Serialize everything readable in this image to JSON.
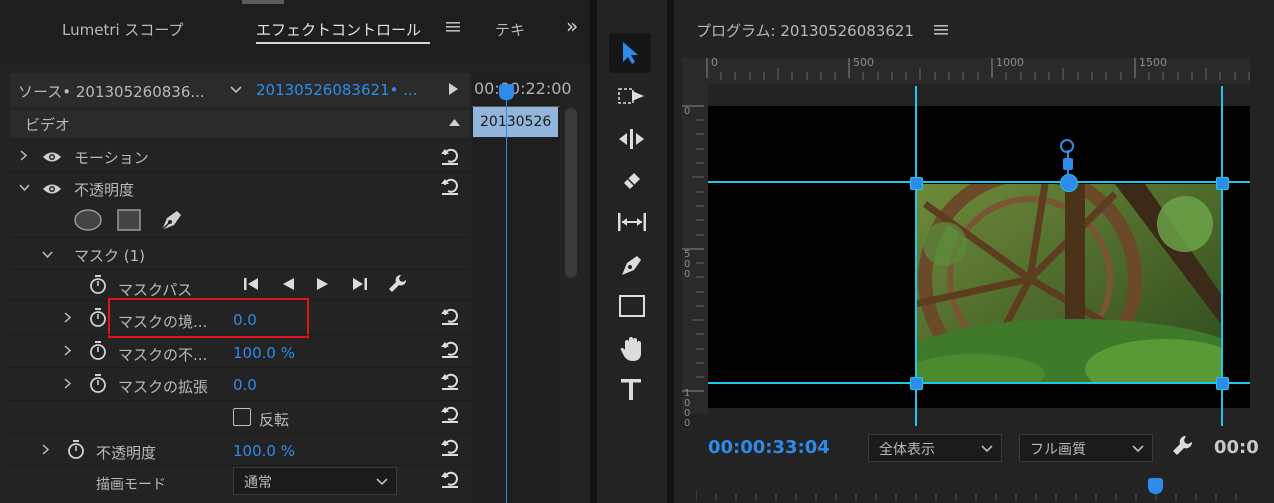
{
  "left_panel": {
    "tabs": [
      {
        "label": "Lumetri スコープ"
      },
      {
        "label": "エフェクトコントロール"
      },
      {
        "label": "テキ"
      }
    ],
    "overflow_glyph": "»",
    "source_clip": "ソース• 201305260836...",
    "sequence_clip": "20130526083621• ...",
    "timecode": "00:00:22:00",
    "timeline_clip": "20130526",
    "section_video": "ビデオ",
    "motion_label": "モーション",
    "opacity_group_label": "不透明度",
    "mask_label": "マスク (1)",
    "mask_path_label": "マスクパス",
    "mask_feather": {
      "label": "マスクの境...",
      "value": "0.0"
    },
    "mask_opacity": {
      "label": "マスクの不...",
      "value": "100.0 %"
    },
    "mask_expansion": {
      "label": "マスクの拡張",
      "value": "0.0"
    },
    "invert_label": "反転",
    "opacity": {
      "label": "不透明度",
      "value": "100.0 %"
    },
    "blend_mode": {
      "label": "描画モード",
      "value": "通常"
    }
  },
  "program_monitor": {
    "title": "プログラム: 20130526083621",
    "ruler_ticks": [
      "0",
      "500",
      "1000",
      "1500"
    ],
    "ruler_left_ticks": [
      "0",
      "5 0 0",
      "1 0 0 0"
    ],
    "timecode": "00:00:33:04",
    "zoom_value": "全体表示",
    "quality_value": "フル画質",
    "timecode_right": "00:0"
  },
  "colors": {
    "accent_blue": "#2d8ceb",
    "guide_cyan": "#1ec8e6",
    "highlight_red": "#e0141e"
  }
}
